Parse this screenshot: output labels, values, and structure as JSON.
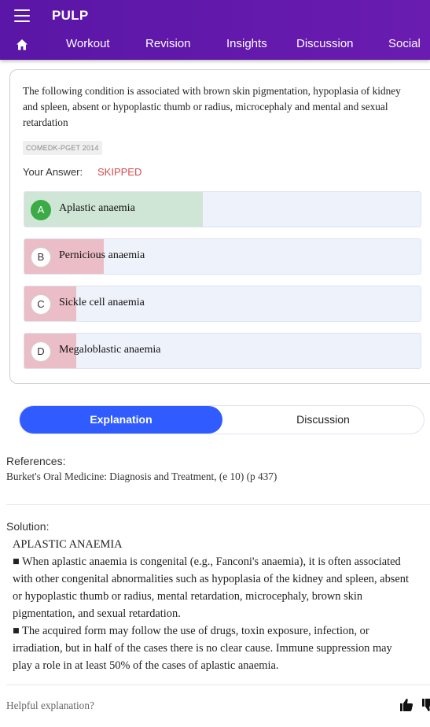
{
  "app": {
    "title": "PULP"
  },
  "nav": {
    "items": [
      "Workout",
      "Revision",
      "Insights",
      "Discussion",
      "Social"
    ]
  },
  "question": {
    "text": "The following condition is associated with brown skin pigmentation, hypoplasia of kidney and spleen, absent or hypoplastic thumb or radius, microcephaly and mental and sexual retardation",
    "tag": "COMEDK-PGET 2014",
    "your_answer_label": "Your Answer:",
    "your_answer_value": "SKIPPED",
    "options": [
      {
        "letter": "A",
        "text": "Aplastic anaemia",
        "correct": true,
        "fill_fraction": 0.45,
        "fill_color": "#cfe6d6"
      },
      {
        "letter": "B",
        "text": "Pernicious anaemia",
        "correct": false,
        "fill_fraction": 0.2,
        "fill_color": "#ebbdc6"
      },
      {
        "letter": "C",
        "text": "Sickle cell anaemia",
        "correct": false,
        "fill_fraction": 0.13,
        "fill_color": "#ebbdc6"
      },
      {
        "letter": "D",
        "text": "Megaloblastic anaemia",
        "correct": false,
        "fill_fraction": 0.13,
        "fill_color": "#ebbdc6"
      }
    ]
  },
  "tabs": {
    "explanation": "Explanation",
    "discussion": "Discussion"
  },
  "references": {
    "label": "References:",
    "text": "Burket's Oral Medicine: Diagnosis and Treatment, (e 10) (p 437)"
  },
  "solution": {
    "label": "Solution:",
    "lines": [
      "APLASTIC ANAEMIA",
      "■ When aplastic anaemia is congenital (e.g., Fanconi's anaemia), it is often associated",
      "with other congenital abnormalities such as hypoplasia of the kidney and spleen, absent",
      "or hypoplastic thumb or radius, mental retardation, microcephaly, brown skin",
      "pigmentation, and sexual retardation.",
      "■ The acquired form may follow the use of drugs, toxin exposure, infection, or",
      "irradiation, but in half of the cases there is no clear cause. Immune suppression may",
      "play a role in at least 50% of the cases of aplastic anaemia."
    ]
  },
  "feedback": {
    "prompt": "Helpful explanation?"
  },
  "icons": {
    "menu": "menu-icon",
    "home": "home-icon",
    "thumbs_up": "thumbs-up-icon",
    "thumbs_down": "thumbs-down-icon"
  },
  "colors": {
    "appbar": "#5a16a6",
    "tab_active": "#2f5bff",
    "correct": "#3aab45",
    "skipped": "#d84a4a"
  }
}
